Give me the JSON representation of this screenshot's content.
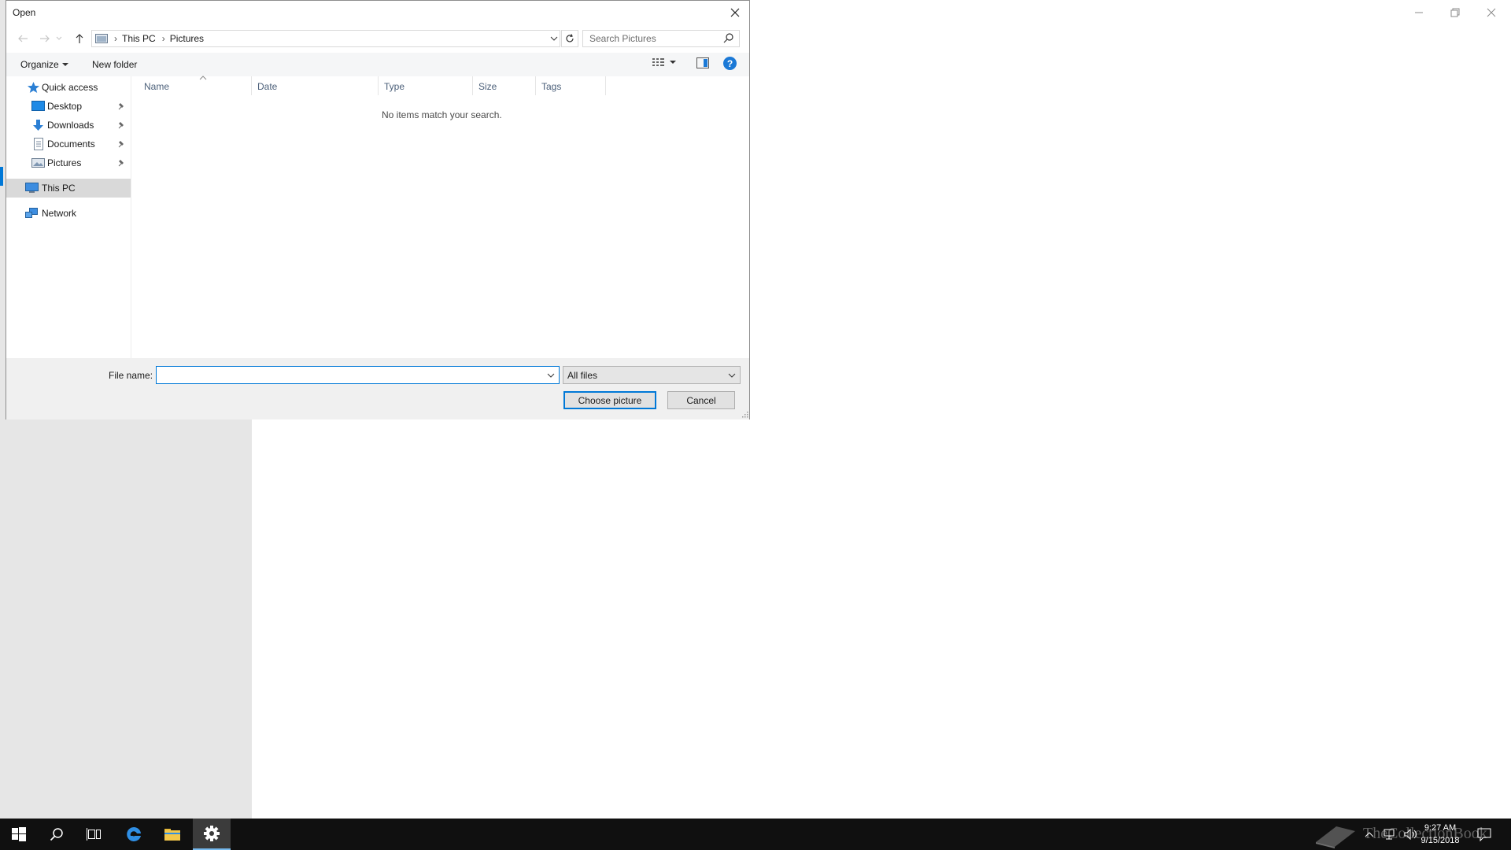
{
  "dialog": {
    "title": "Open",
    "address": {
      "crumbs": [
        "This PC",
        "Pictures"
      ]
    },
    "search": {
      "placeholder": "Search Pictures"
    },
    "toolbar": {
      "organize_label": "Organize",
      "new_folder_label": "New folder",
      "help_glyph": "?"
    },
    "nav_pane": {
      "items": [
        {
          "label": "Quick access",
          "icon": "star-icon"
        },
        {
          "label": "Desktop",
          "icon": "desktop-folder-icon",
          "pinned": true
        },
        {
          "label": "Downloads",
          "icon": "download-arrow-icon",
          "pinned": true
        },
        {
          "label": "Documents",
          "icon": "document-icon",
          "pinned": true
        },
        {
          "label": "Pictures",
          "icon": "pictures-folder-icon",
          "pinned": true
        },
        {
          "label": "This PC",
          "icon": "computer-icon",
          "selected": true
        },
        {
          "label": "Network",
          "icon": "network-icon"
        }
      ]
    },
    "columns": [
      "Name",
      "Date",
      "Type",
      "Size",
      "Tags"
    ],
    "empty_message": "No items match your search.",
    "file_name": {
      "label": "File name:",
      "value": ""
    },
    "file_type": {
      "selected": "All files"
    },
    "buttons": {
      "choose": "Choose picture",
      "cancel": "Cancel"
    }
  },
  "taskbar": {
    "apps": [
      "start-icon",
      "search-icon",
      "task-view-icon",
      "edge-icon",
      "file-explorer-icon",
      "settings-icon"
    ],
    "clock": {
      "time": "9:27 AM",
      "date": "9/15/2018"
    },
    "watermark": "TheCollectionBook"
  },
  "colors": {
    "accent": "#0078d7",
    "taskbar": "#101010",
    "settings_sidebar": "#e6e6e6"
  }
}
